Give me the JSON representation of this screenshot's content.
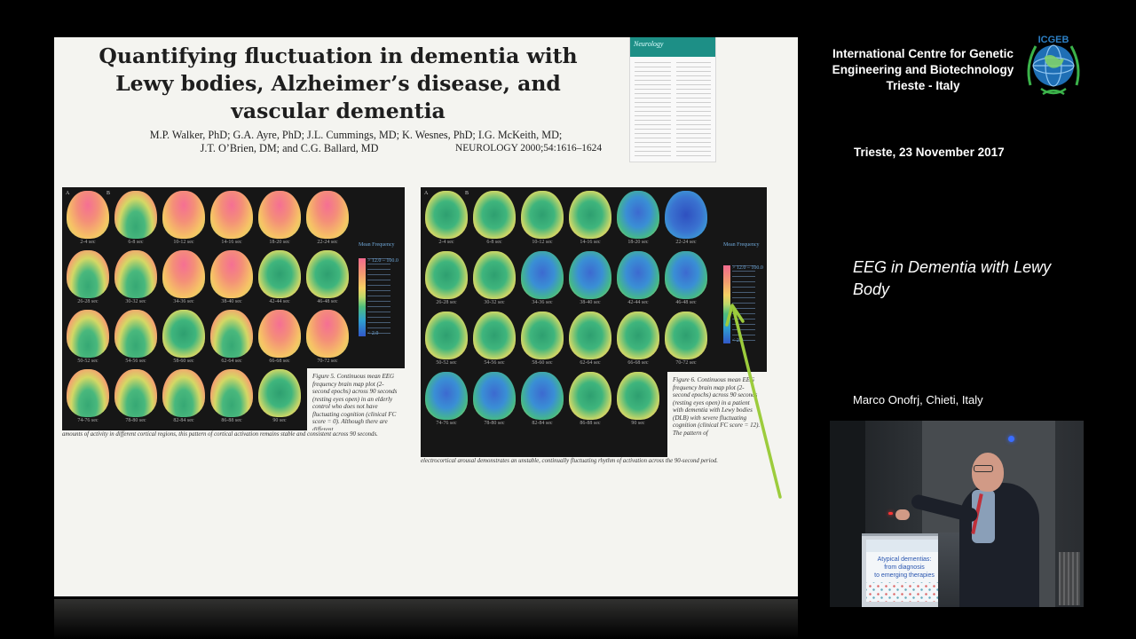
{
  "slide": {
    "paper_title": "Quantifying fluctuation in dementia with Lewy bodies, Alzheimer’s disease, and vascular dementia",
    "authors_line1": "M.P. Walker, PhD; G.A. Ayre, PhD; J.L. Cummings, MD; K. Wesnes, PhD; I.G. McKeith, MD;",
    "authors_line2": "J.T. O’Brien, DM; and C.G. Ballard, MD",
    "journal_ref": "NEUROLOGY 2000;54:1616–1624",
    "thumbnail_header": "Neurology",
    "figure5": {
      "panel_letters": [
        "A",
        "B"
      ],
      "legend_title": "Mean Frequency",
      "legend_top_value": "> 12.0 – 100.0",
      "legend_bottom_value": "< 2.0",
      "time_labels": [
        "2-4 sec",
        "6-8 sec",
        "10-12 sec",
        "14-16 sec",
        "18-20 sec",
        "22-24 sec",
        "26-28 sec",
        "30-32 sec",
        "34-36 sec",
        "38-40 sec",
        "42-44 sec",
        "46-48 sec",
        "50-52 sec",
        "54-56 sec",
        "58-60 sec",
        "62-64 sec",
        "66-68 sec",
        "70-72 sec",
        "74-76 sec",
        "78-80 sec",
        "82-84 sec",
        "86-88 sec",
        "90 sec"
      ],
      "caption": "Figure 5. Continuous mean EEG frequency brain map plot (2-second epochs) across 90 seconds (resting eyes open) in an elderly control who does not have fluctuating cognition (clinical FC score = 0). Although there are different",
      "caption_continued": "amounts of activity in different cortical regions, this pattern of cortical activation remains stable and consistent across 90 seconds."
    },
    "figure6": {
      "panel_letters": [
        "A",
        "B"
      ],
      "legend_title": "Mean Frequency",
      "legend_top_value": "> 12.0 – 100.0",
      "legend_bottom_value": "< 2.0",
      "time_labels": [
        "2-4 sec",
        "6-8 sec",
        "10-12 sec",
        "14-16 sec",
        "18-20 sec",
        "22-24 sec",
        "26-28 sec",
        "30-32 sec",
        "34-36 sec",
        "38-40 sec",
        "42-44 sec",
        "46-48 sec",
        "50-52 sec",
        "54-56 sec",
        "58-60 sec",
        "62-64 sec",
        "66-68 sec",
        "70-72 sec",
        "74-76 sec",
        "78-80 sec",
        "82-84 sec",
        "86-88 sec",
        "90 sec"
      ],
      "caption": "Figure 6. Continuous mean EEG frequency brain map plot (2-second epochs) across 90 seconds (resting eyes open) in a patient with dementia with Lewy bodies (DLB) with severe fluctuating cognition (clinical FC score = 12). The pattern of",
      "caption_continued": "electrocortical arousal demonstrates an unstable, continually fluctuating rhythm of activation across the 90-second period."
    },
    "pointer_color": "#9ccc3c"
  },
  "panel": {
    "institution": "International Centre for Genetic Engineering and Biotechnology Trieste - Italy",
    "logo_text": "ICGEB",
    "date": "Trieste, 23 November 2017",
    "talk_title": "EEG in Dementia with Lewy Body",
    "speaker": "Marco Onofrj, Chieti, Italy"
  },
  "video": {
    "sign_line1": "Atypical dementias:",
    "sign_line2": "from diagnosis",
    "sign_line3": "to emerging therapies"
  },
  "colors": {
    "background": "#000000",
    "slide_bg": "#f4f4f0",
    "logo_blue": "#2c7fc4",
    "logo_green": "#3bb24a"
  }
}
